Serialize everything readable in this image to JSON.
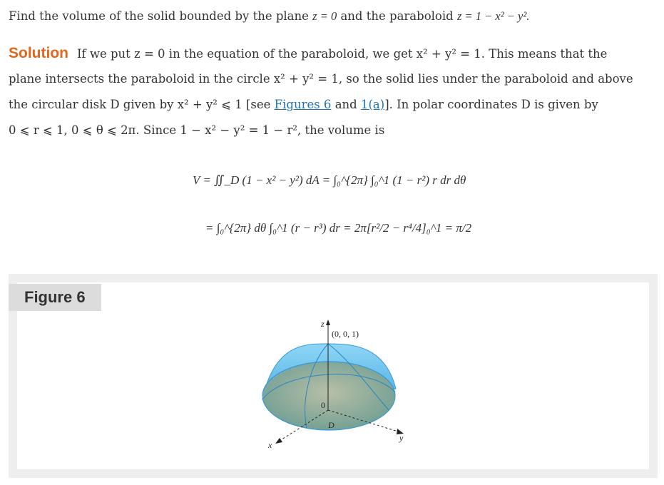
{
  "problem": {
    "text_before": "Find the volume of the solid bounded by the plane",
    "plane_eq": "z = 0",
    "text_mid": "and the paraboloid",
    "paraboloid_eq": "z = 1 − x² − y².",
    "full": "Find the volume of the solid bounded by the plane z = 0 and the paraboloid z = 1 − x² − y²."
  },
  "solution": {
    "label": "Solution",
    "line1": "If we put z = 0 in the equation of the paraboloid, we get x² + y² = 1. This means that the",
    "line2": "plane intersects the paraboloid in the circle x² + y² = 1, so the solid lies under the paraboloid and above",
    "line3_before": "the circular disk D given by x² + y² ⩽ 1 [see",
    "link_figures6": "Figures 6",
    "and": "and",
    "link_1a": "1(a)",
    "line3_after": "]. In polar coordinates D is given by",
    "line4": "0 ⩽ r ⩽ 1, 0 ⩽ θ ⩽ 2π. Since 1 − x² − y² = 1 − r², the volume is"
  },
  "equations": {
    "eq1": "V = ∬_D (1 − x² − y²) dA = ∫₀^{2π} ∫₀^1 (1 − r²) r dr dθ",
    "eq2": "= ∫₀^{2π} dθ ∫₀^1 (r − r³) dr = 2π[r²/2 − r⁴/4]₀^1 = π/2"
  },
  "figure": {
    "tag": "Figure 6",
    "labels": {
      "z": "z",
      "x": "x",
      "y": "y",
      "point": "(0, 0, 1)",
      "origin": "0",
      "disk": "D"
    },
    "colors": {
      "dome": "#6cc3ee",
      "disk": "#9aa58d",
      "accent": "#e0661b",
      "link": "#1f73b7"
    }
  }
}
